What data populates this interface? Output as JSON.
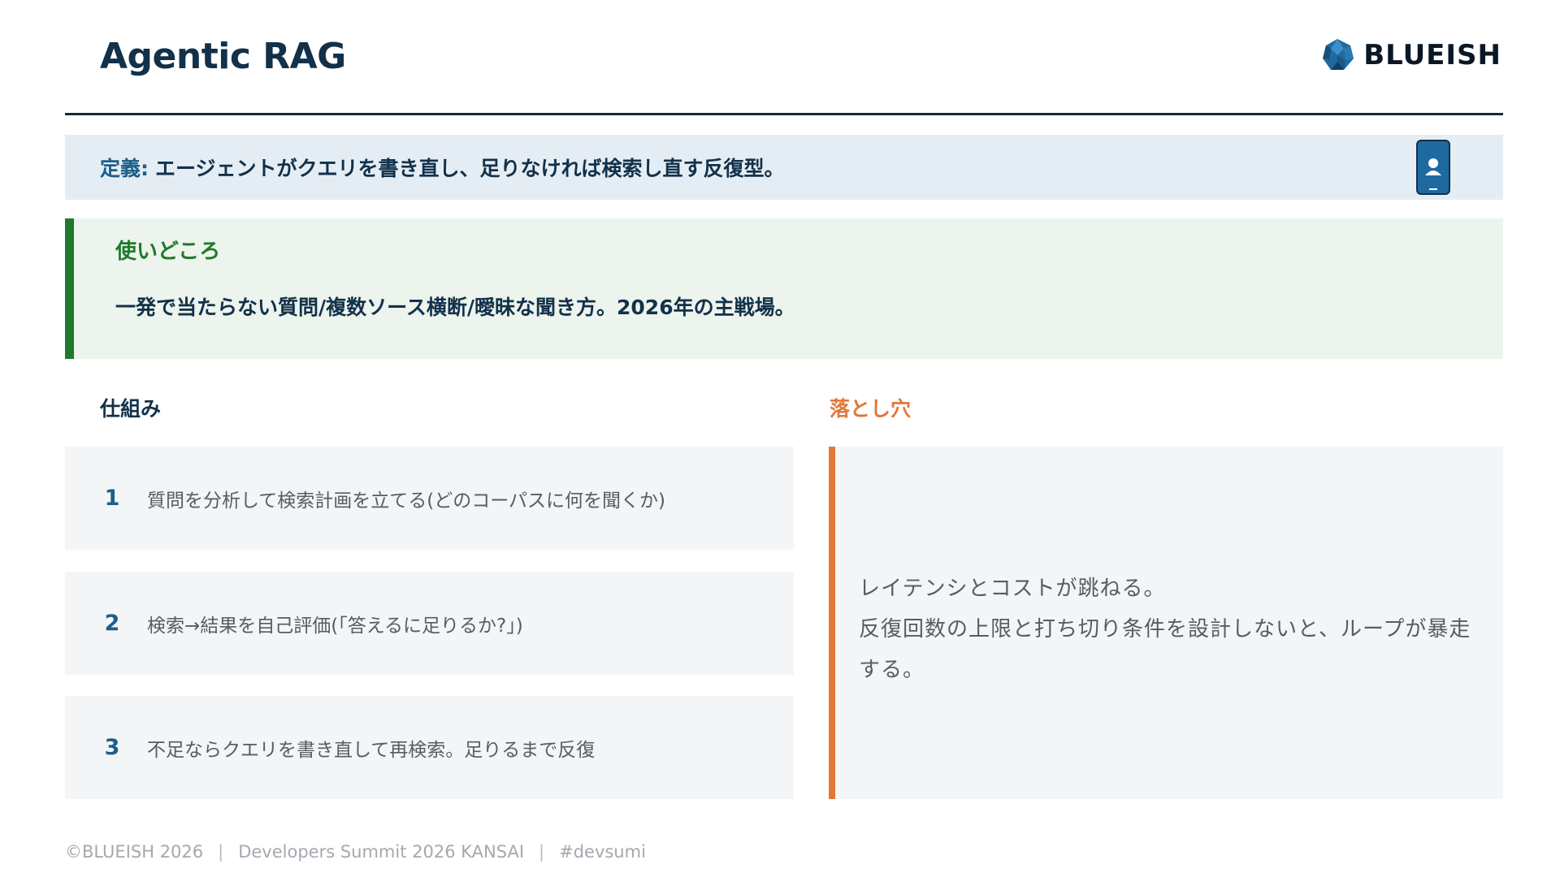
{
  "slide": {
    "title": "Agentic RAG",
    "logo_text": "BLUEISH"
  },
  "definition": {
    "label": "定義:",
    "text": "エージェントがクエリを書き直し、足りなければ検索し直す反復型。",
    "icon": "smartphone-person-icon"
  },
  "usage": {
    "heading": "使いどころ",
    "text": "一発で当たらない質問/複数ソース横断/曖昧な聞き方。2026年の主戦場。"
  },
  "mechanism": {
    "heading": "仕組み",
    "steps": [
      {
        "num": "1",
        "text": "質問を分析して検索計画を立てる(どのコーパスに何を聞くか)"
      },
      {
        "num": "2",
        "text": "検索→結果を自己評価(「答えるに足りるか?」)"
      },
      {
        "num": "3",
        "text": "不足ならクエリを書き直して再検索。足りるまで反復"
      }
    ]
  },
  "pitfalls": {
    "heading": "落とし穴",
    "lines": [
      "レイテンシとコストが跳ねる。",
      "反復回数の上限と打ち切り条件を設計しないと、ループが暴走する。"
    ]
  },
  "footer": {
    "copyright": "©BLUEISH 2026",
    "event": "Developers Summit 2026 KANSAI",
    "hashtag": "#devsumi"
  },
  "colors": {
    "accent_blue": "#1d5f8a",
    "accent_green": "#1f7a2c",
    "accent_orange": "#e1783a"
  }
}
